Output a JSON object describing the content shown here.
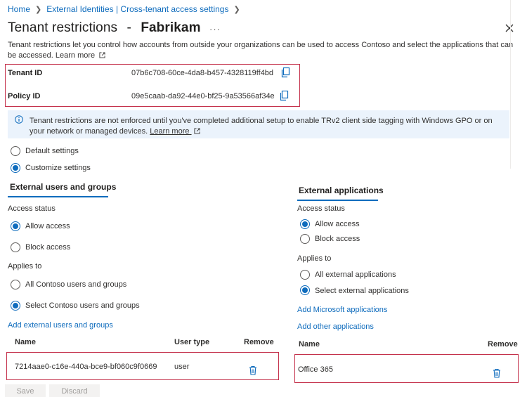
{
  "breadcrumb": {
    "items": [
      "Home",
      "External Identities | Cross-tenant access settings"
    ]
  },
  "title": {
    "prefix": "Tenant restrictions",
    "dash": "-",
    "org": "Fabrikam",
    "more": "···"
  },
  "description": {
    "text": "Tenant restrictions let you control how accounts from outside your organizations can be used to access Contoso and select the applications that can be accessed.",
    "learn_more": "Learn more"
  },
  "ids": {
    "tenant_label": "Tenant ID",
    "tenant_value": "07b6c708-60ce-4da8-b457-4328119ff4bd",
    "policy_label": "Policy ID",
    "policy_value": "09e5caab-da92-44e0-bf25-9a53566af34e"
  },
  "banner": {
    "text": "Tenant restrictions are not enforced until you've completed additional setup to enable TRv2 client side tagging with Windows GPO or on your network or managed devices.",
    "learn_more": "Learn more"
  },
  "settings": {
    "options": [
      "Default settings",
      "Customize settings"
    ],
    "selected": "Customize settings"
  },
  "users_groups": {
    "tab": "External users and groups",
    "access_status_label": "Access status",
    "access_options": [
      "Allow access",
      "Block access"
    ],
    "access_selected": "Allow access",
    "applies_to_label": "Applies to",
    "applies_options": [
      "All Contoso users and groups",
      "Select Contoso users and groups"
    ],
    "applies_selected": "Select Contoso users and groups",
    "add_link": "Add external users and groups",
    "columns": [
      "Name",
      "User type",
      "Remove"
    ],
    "rows": [
      {
        "name": "7214aae0-c16e-440a-bce9-bf060c9f0669",
        "type": "user"
      }
    ]
  },
  "applications": {
    "tab": "External applications",
    "access_status_label": "Access status",
    "access_options": [
      "Allow access",
      "Block access"
    ],
    "access_selected": "Allow access",
    "applies_to_label": "Applies to",
    "applies_options": [
      "All external applications",
      "Select external applications"
    ],
    "applies_selected": "Select external applications",
    "add_ms_link": "Add Microsoft applications",
    "add_other_link": "Add other applications",
    "columns": [
      "Name",
      "Remove"
    ],
    "rows": [
      {
        "name": "Office 365"
      }
    ]
  },
  "footer": {
    "save": "Save",
    "discard": "Discard"
  },
  "colors": {
    "accent": "#0f6cbd",
    "highlight_border": "#c4314b",
    "banner_bg": "#ebf3fc"
  }
}
